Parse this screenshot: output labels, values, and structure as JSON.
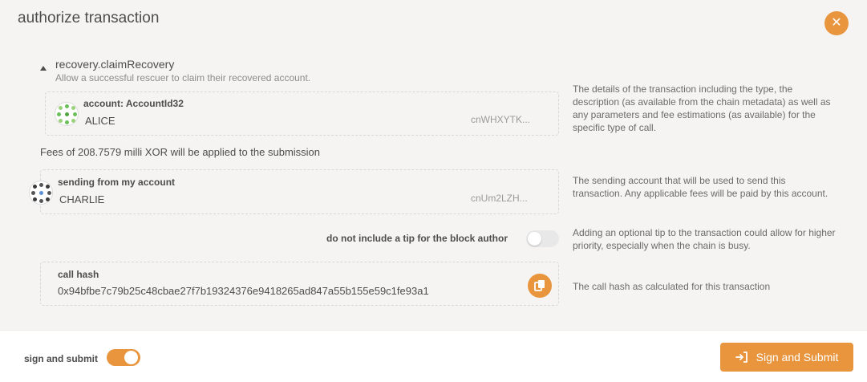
{
  "modal": {
    "title": "authorize transaction",
    "close_icon": "close-icon",
    "accent_color": "#e8953d"
  },
  "call": {
    "method": "recovery.claimRecovery",
    "description": "Allow a successful rescuer to claim their recovered account.",
    "param": {
      "label": "account: AccountId32",
      "name": "ALICE",
      "address": "cnWHXYTK..."
    },
    "help": "The details of the transaction including the type, the description (as available from the chain metadata) as well as any parameters and fee estimations (as available) for the specific type of call."
  },
  "fees": "Fees of 208.7579 milli XOR will be applied to the submission",
  "sender": {
    "label": "sending from my account",
    "name": "CHARLIE",
    "address": "cnUm2LZH...",
    "help": "The sending account that will be used to send this transaction. Any applicable fees will be paid by this account."
  },
  "tip": {
    "label": "do not include a tip for the block author",
    "enabled": false,
    "help": "Adding an optional tip to the transaction could allow for higher priority, especially when the chain is busy."
  },
  "call_hash": {
    "label": "call hash",
    "value": "0x94bfbe7c79b25c48cbae27f7b19324376e9418265ad847a55b155e59c1fe93a1",
    "help": "The call hash as calculated for this transaction",
    "copy_icon": "copy-icon"
  },
  "footer": {
    "sign_label": "sign and submit",
    "sign_enabled": true,
    "submit_label": "Sign and Submit",
    "submit_icon": "sign-in-icon"
  }
}
